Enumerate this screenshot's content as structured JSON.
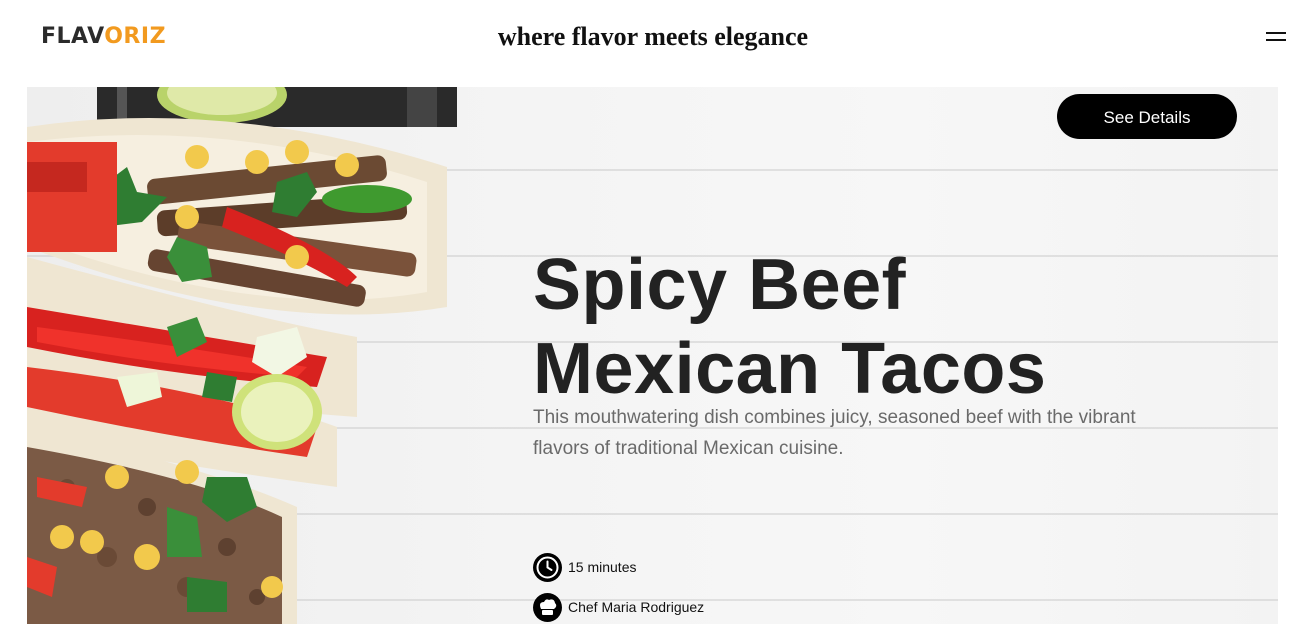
{
  "header": {
    "logo_part1": "FLAV",
    "logo_part2": "ORIZ",
    "tagline": "where flavor meets elegance",
    "menu_icon": "hamburger-menu-icon"
  },
  "hero": {
    "image": "beef-tacos-photo",
    "details_button": "See Details",
    "title_line1": "Spicy Beef",
    "title_line2": "Mexican Tacos",
    "description": "This mouthwatering dish combines juicy, seasoned beef with the vibrant flavors of traditional Mexican cuisine.",
    "meta": [
      {
        "icon": "clock-icon",
        "text": "15 minutes"
      },
      {
        "icon": "chef-hat-icon",
        "text": "Chef Maria Rodriguez"
      }
    ]
  },
  "colors": {
    "brand_dark": "#2b2b2b",
    "brand_accent": "#f29a1f",
    "button_bg": "#000000",
    "title_text": "#222222",
    "description_text": "#6a6a6a"
  }
}
